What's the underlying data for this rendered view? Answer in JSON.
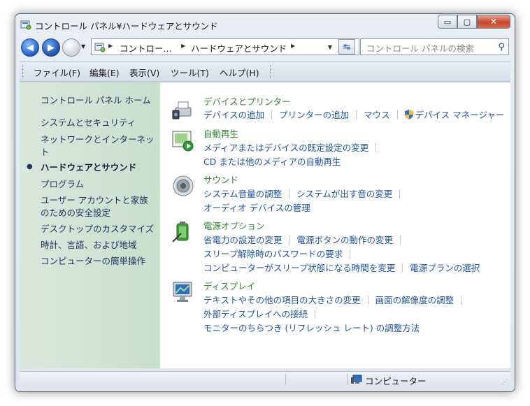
{
  "window": {
    "title": "コントロール パネル¥ハードウェアとサウンド"
  },
  "caption": {
    "minimize": "▭",
    "maximize": "▢",
    "close": "✕"
  },
  "nav": {
    "back_glyph": "◀",
    "forward_glyph": "▶",
    "breadcrumbs": [
      "コントロー...",
      "ハードウェアとサウンド"
    ],
    "refresh_glyph": "↹"
  },
  "search": {
    "placeholder": "コントロール パネルの検索"
  },
  "menu": [
    "ファイル(F)",
    "編集(E)",
    "表示(V)",
    "ツール(T)",
    "ヘルプ(H)"
  ],
  "sidebar": {
    "home": "コントロール パネル ホーム",
    "items": [
      {
        "label": "システムとセキュリティ",
        "active": false
      },
      {
        "label": "ネットワークとインターネット",
        "active": false
      },
      {
        "label": "ハードウェアとサウンド",
        "active": true
      },
      {
        "label": "プログラム",
        "active": false
      },
      {
        "label": "ユーザー アカウントと家族のための安全設定",
        "active": false
      },
      {
        "label": "デスクトップのカスタマイズ",
        "active": false
      },
      {
        "label": "時計、言語、および地域",
        "active": false
      },
      {
        "label": "コンピューターの簡単操作",
        "active": false
      }
    ]
  },
  "categories": [
    {
      "title": "デバイスとプリンター",
      "icon": "devices-printer-icon",
      "rows": [
        [
          "デバイスの追加",
          "プリンターの追加",
          "マウス",
          "デバイス マネージャー"
        ]
      ]
    },
    {
      "title": "自動再生",
      "icon": "autoplay-icon",
      "rows": [
        [
          "メディアまたはデバイスの既定設定の変更"
        ],
        [
          "CD または他のメディアの自動再生"
        ]
      ]
    },
    {
      "title": "サウンド",
      "icon": "speaker-icon",
      "rows": [
        [
          "システム音量の調整",
          "システムが出す音の変更"
        ],
        [
          "オーディオ デバイスの管理"
        ]
      ]
    },
    {
      "title": "電源オプション",
      "icon": "battery-icon",
      "rows": [
        [
          "省電力の設定の変更",
          "電源ボタンの動作の変更"
        ],
        [
          "スリープ解除時のパスワードの要求"
        ],
        [
          "コンピューターがスリープ状態になる時間を変更",
          "電源プランの選択"
        ]
      ]
    },
    {
      "title": "ディスプレイ",
      "icon": "display-icon",
      "rows": [
        [
          "テキストやその他の項目の大きさの変更",
          "画面の解像度の調整"
        ],
        [
          "外部ディスプレイへの接続"
        ],
        [
          "モニターのちらつき (リフレッシュ レート) の調整方法"
        ]
      ]
    }
  ],
  "status": {
    "text": "コンピューター"
  },
  "colors": {
    "link": "#1f56a6",
    "category_title": "#2d8a2d",
    "sidebar_bg": "#d8e8dc"
  }
}
